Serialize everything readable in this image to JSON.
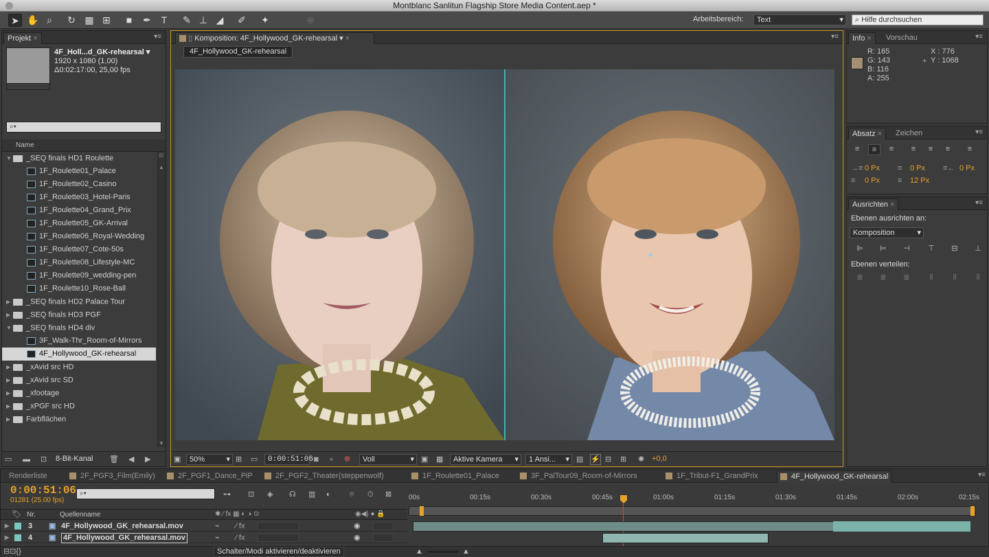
{
  "window": {
    "title": "Montblanc Sanlitun Flagship Store Media Content.aep *"
  },
  "toolbar": {
    "workspace_label": "Arbeitsbereich:",
    "workspace_value": "Text",
    "help_placeholder": "Hilfe durchsuchen"
  },
  "project": {
    "tab": "Projekt",
    "item_name": "4F_Holl...d_GK-rehearsal ▾",
    "item_dims": "1920 x 1080 (1,00)",
    "item_duration": "Δ0:02:17:00, 25,00 fps",
    "search_placeholder": "",
    "col_name": "Name",
    "bit_depth": "8-Bit-Kanal",
    "items": [
      {
        "label": "_SEQ finals HD1 Roulette",
        "kind": "folder",
        "open": true
      },
      {
        "label": "1F_Roulette01_Palace",
        "kind": "comp"
      },
      {
        "label": "1F_Roulette02_Casino",
        "kind": "comp"
      },
      {
        "label": "1F_Roulette03_Hotel-Paris",
        "kind": "comp"
      },
      {
        "label": "1F_Roulette04_Grand_Prix",
        "kind": "comp"
      },
      {
        "label": "1F_Roulette05_GK-Arrival",
        "kind": "comp"
      },
      {
        "label": "1F_Roulette06_Royal-Wedding",
        "kind": "comp"
      },
      {
        "label": "1F_Roulette07_Cote-50s",
        "kind": "comp"
      },
      {
        "label": "1F_Roulette08_Lifestyle-MC",
        "kind": "comp"
      },
      {
        "label": "1F_Roulette09_wedding-pen",
        "kind": "comp"
      },
      {
        "label": "1F_Roulette10_Rose-Ball",
        "kind": "comp"
      },
      {
        "label": "_SEQ finals HD2 Palace Tour",
        "kind": "folder",
        "open": false
      },
      {
        "label": "_SEQ finals HD3 PGF",
        "kind": "folder",
        "open": false
      },
      {
        "label": "_SEQ finals HD4 div",
        "kind": "folder",
        "open": true
      },
      {
        "label": "3F_Walk-Thr_Room-of-Mirrors",
        "kind": "comp"
      },
      {
        "label": "4F_Hollywood_GK-rehearsal",
        "kind": "comp",
        "selected": true
      },
      {
        "label": "_xAvid src HD",
        "kind": "folder",
        "open": false
      },
      {
        "label": "_xAvid src SD",
        "kind": "folder",
        "open": false
      },
      {
        "label": "_xfootage",
        "kind": "folder",
        "open": false
      },
      {
        "label": "_xPGF src HD",
        "kind": "folder",
        "open": false
      },
      {
        "label": "Farbflächen",
        "kind": "folder",
        "open": false
      }
    ]
  },
  "composition": {
    "tab": "Komposition: 4F_Hollywood_GK-rehearsal",
    "comp_name": "4F_Hollywood_GK-rehearsal",
    "zoom": "50%",
    "timecode": "0:00:51:06",
    "resolution": "Voll",
    "camera": "Aktive Kamera",
    "views": "1 Ansi...",
    "exposure": "+0,0"
  },
  "info": {
    "tab": "Info",
    "tab2": "Vorschau",
    "r": "R:  165",
    "g": "G:  143",
    "b": "B:  116",
    "a": "A:  255",
    "x": "X : 776",
    "y": "Y : 1068",
    "swatch_color": "#a58f74"
  },
  "paragraph": {
    "tab": "Absatz",
    "tab2": "Zeichen",
    "indent_left": "0 Px",
    "indent_first": "0 Px",
    "indent_right": "0 Px",
    "space_before": "0 Px",
    "space_after": "12 Px"
  },
  "align": {
    "tab": "Ausrichten",
    "align_to_label": "Ebenen ausrichten an:",
    "align_to_value": "Komposition",
    "distribute_label": "Ebenen verteilen:"
  },
  "timeline": {
    "tabs": [
      "Renderliste",
      "2F_PGF3_Film(Emily)",
      "2F_PGF1_Dance_PiP",
      "2F_PGF2_Theater(steppenwolf)",
      "1F_Roulette01_Palace",
      "3F_PalTour09_Room-of-Mirrors",
      "1F_Tribut-F1_GrandPrix",
      "4F_Hollywood_GK-rehearsal"
    ],
    "timecode": "0:00:51:06",
    "frames": "01281 (25.00 fps)",
    "col_nr": "Nr.",
    "col_source": "Quellenname",
    "ruler": [
      "00s",
      "00:15s",
      "00:30s",
      "00:45s",
      "01:00s",
      "01:15s",
      "01:30s",
      "01:45s",
      "02:00s",
      "02:15s"
    ],
    "layers": [
      {
        "nr": "3",
        "name": "4F_Hollywood_GK_rehearsal.mov"
      },
      {
        "nr": "4",
        "name": "4F_Hollywood_GK_rehearsal.mov"
      }
    ],
    "toggle_label": "Schalter/Modi aktivieren/deaktivieren"
  },
  "colors": {
    "accent": "#e8a227",
    "track": "#6e9e96",
    "panel": "#3c3c3c"
  }
}
